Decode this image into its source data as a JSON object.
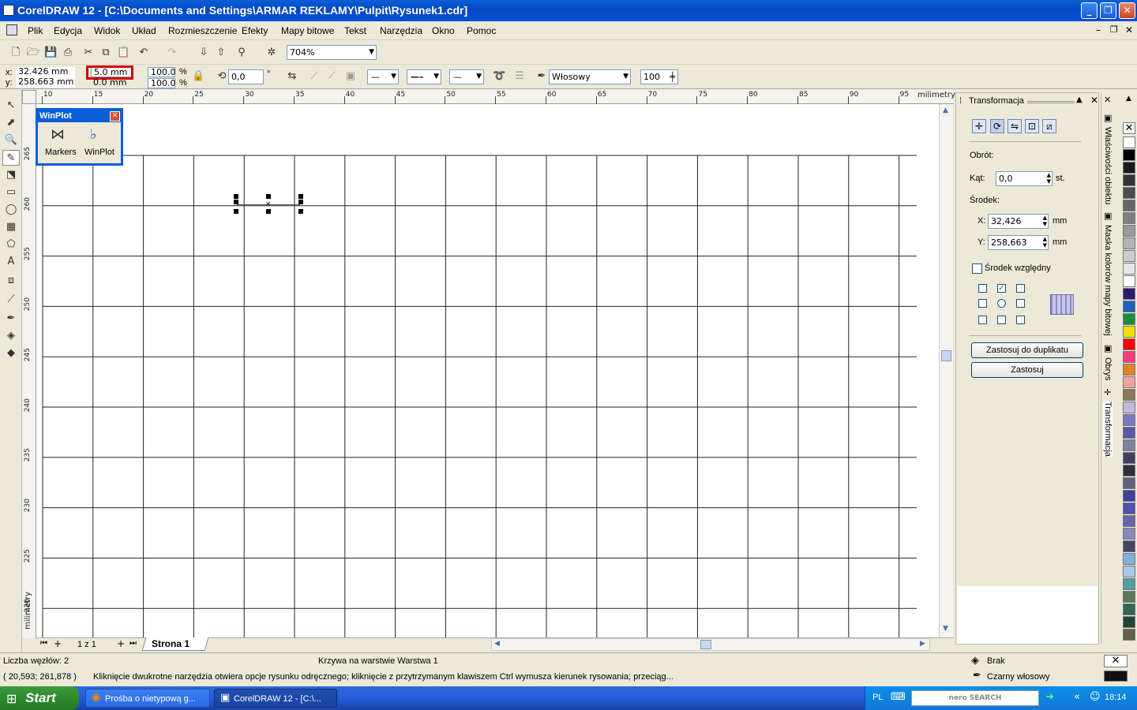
{
  "window": {
    "title": "CorelDRAW 12 - [C:\\Documents and Settings\\ARMAR REKLAMY\\Pulpit\\Rysunek1.cdr]"
  },
  "menu": [
    "Plik",
    "Edycja",
    "Widok",
    "Układ",
    "Rozmieszczenie",
    "Efekty",
    "Mapy bitowe",
    "Tekst",
    "Narzędzia",
    "Okno",
    "Pomoc"
  ],
  "toolbar": {
    "zoom": "704%"
  },
  "propbar": {
    "x": "32.426 mm",
    "y": "258.663 mm",
    "w": "5.0 mm",
    "h": "0.0 mm",
    "sx": "100.0",
    "sy": "100.0",
    "pct": "%",
    "rot": "0,0",
    "deg": "°",
    "outline": "Włosowy",
    "smooth": "100"
  },
  "ruler": {
    "unit": "milimetry",
    "hticks": [
      "10",
      "15",
      "20",
      "25",
      "30",
      "35",
      "40",
      "45",
      "50",
      "55",
      "60",
      "65",
      "70",
      "75",
      "80",
      "85",
      "90",
      "95"
    ],
    "vticks": [
      "265",
      "260",
      "255",
      "250",
      "245",
      "240",
      "235",
      "230",
      "225",
      "220"
    ]
  },
  "winplot": {
    "title": "WinPlot",
    "items": [
      "Markers",
      "WinPlot"
    ]
  },
  "pages": {
    "counter": "1 z 1",
    "tab": "Strona 1"
  },
  "docker": {
    "title": "Transformacja",
    "rot_label": "Obrót:",
    "angle_label": "Kąt:",
    "angle": "0,0",
    "angle_unit": "st.",
    "center_label": "Środek:",
    "x_label": "X:",
    "x": "32,426",
    "y_label": "Y:",
    "y": "258,663",
    "unit": "mm",
    "relative": "Środek względny",
    "dup_btn": "Zastosuj do duplikatu",
    "apply_btn": "Zastosuj"
  },
  "vtabs": [
    "Właściwości obiektu",
    "Maska kolorów mapy bitowej",
    "Obrys",
    "Transformacja"
  ],
  "status": {
    "nodes": "Liczba węzłów: 2",
    "layer": "Krzywa na warstwie Warstwa 1",
    "coords": "( 20,593; 261,878 )",
    "hint": "Kliknięcie dwukrotne narzędzia otwiera opcje rysunku odręcznego; kliknięcie z przytrzymanym klawiszem Ctrl wymusza kierunek rysowania; przeciąg...",
    "fill": "Brak",
    "outline": "Czarny włosowy"
  },
  "taskbar": {
    "start": "Start",
    "tasks": [
      "Prośba o nietypową g...",
      "CorelDRAW 12 - [C:\\..."
    ],
    "lang": "PL",
    "search": "nero SEARCH",
    "clock": "18:14"
  },
  "palette": [
    "#ffffff",
    "#000000",
    "#1a1a1a",
    "#333333",
    "#4d4d4d",
    "#666666",
    "#808080",
    "#999999",
    "#b3b3b3",
    "#cccccc",
    "#e6e6e6",
    "#ffffff",
    "#2e1a6e",
    "#1f5fbf",
    "#1a8f3a",
    "#f0e000",
    "#ff0000",
    "#ff3d7a",
    "#e0802a",
    "#f5a0a0",
    "#8a7a5a",
    "#c8b6e0",
    "#7a78c0",
    "#5a58a8",
    "#8080a0",
    "#404060",
    "#303040",
    "#606080",
    "#4040a0",
    "#5050b0",
    "#6666aa",
    "#8888bb",
    "#444466",
    "#7fb0e0",
    "#a8c8e8",
    "#50a0a0",
    "#5a7a5a",
    "#336655",
    "#224433",
    "#606040"
  ]
}
